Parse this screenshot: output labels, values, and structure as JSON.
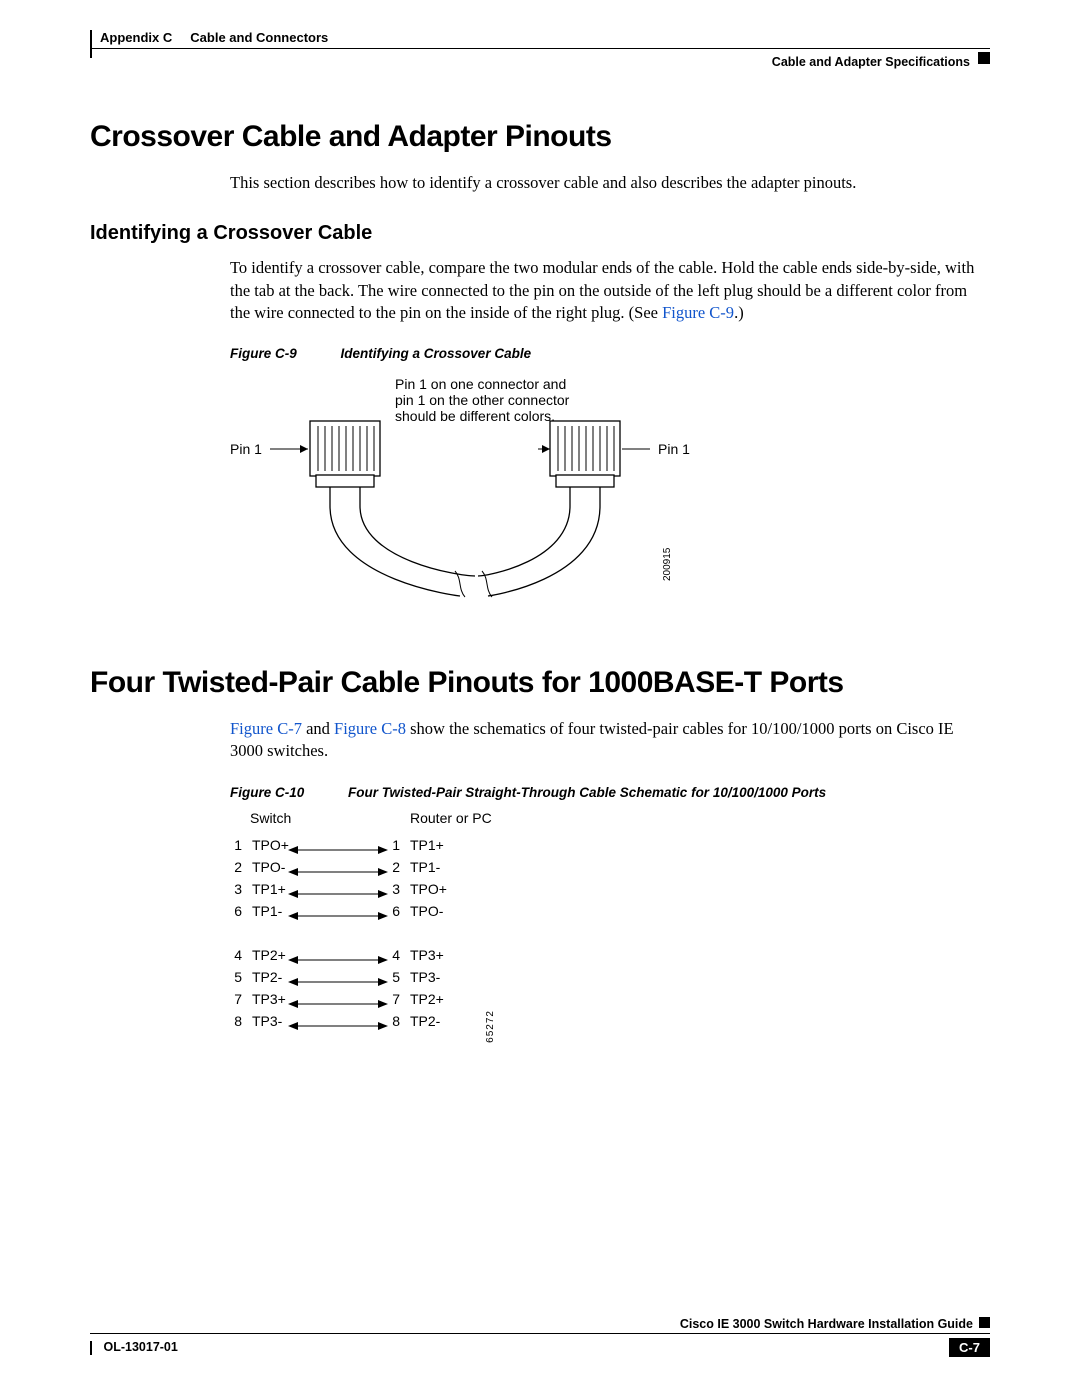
{
  "header": {
    "appendix": "Appendix C",
    "chapter": "Cable and Connectors",
    "subsection": "Cable and Adapter Specifications"
  },
  "section1": {
    "title": "Crossover Cable and Adapter Pinouts",
    "intro": "This section describes how to identify a crossover cable and also describes the adapter pinouts."
  },
  "sub1": {
    "title": "Identifying a Crossover Cable",
    "para_a": "To identify a crossover cable, compare the two modular ends of the cable. Hold the cable ends side-by-side, with the tab at the back. The wire connected to the pin on the outside of the left plug should be a different color from the wire connected to the pin on the inside of the right plug. (See ",
    "para_link": "Figure C-9",
    "para_b": ".)"
  },
  "fig_c9": {
    "num": "Figure C-9",
    "title": "Identifying a Crossover Cable",
    "note_l1": "Pin 1 on one connector and",
    "note_l2": "pin 1 on the other connector",
    "note_l3": "should be different colors.",
    "pin_left": "Pin 1",
    "pin_right": "Pin 1",
    "artno": "200915"
  },
  "section2": {
    "title": "Four Twisted-Pair Cable Pinouts for 1000BASE-T Ports",
    "para_link1": "Figure C-7",
    "para_mid": " and ",
    "para_link2": "Figure C-8",
    "para_rest": " show the schematics of four twisted-pair cables for 10/100/1000 ports on Cisco IE 3000 switches."
  },
  "fig_c10": {
    "num": "Figure C-10",
    "title": "Four Twisted-Pair Straight-Through Cable Schematic for 10/100/1000 Ports",
    "left_header": "Switch",
    "right_header": "Router or PC",
    "artno": "65272",
    "rows1": [
      {
        "ln": "1",
        "ls": "TPO+",
        "rn": "1",
        "rs": "TP1+"
      },
      {
        "ln": "2",
        "ls": "TPO-",
        "rn": "2",
        "rs": "TP1-"
      },
      {
        "ln": "3",
        "ls": "TP1+",
        "rn": "3",
        "rs": "TPO+"
      },
      {
        "ln": "6",
        "ls": "TP1-",
        "rn": "6",
        "rs": "TPO-"
      }
    ],
    "rows2": [
      {
        "ln": "4",
        "ls": "TP2+",
        "rn": "4",
        "rs": "TP3+"
      },
      {
        "ln": "5",
        "ls": "TP2-",
        "rn": "5",
        "rs": "TP3-"
      },
      {
        "ln": "7",
        "ls": "TP3+",
        "rn": "7",
        "rs": "TP2+"
      },
      {
        "ln": "8",
        "ls": "TP3-",
        "rn": "8",
        "rs": "TP2-"
      }
    ]
  },
  "footer": {
    "guide": "Cisco IE 3000 Switch Hardware Installation Guide",
    "docno": "OL-13017-01",
    "pageno": "C-7"
  }
}
